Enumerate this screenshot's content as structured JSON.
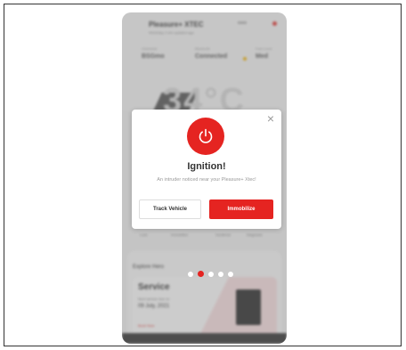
{
  "background_app": {
    "title": "Pleasure+ XTEC",
    "subtitle": "Weekday 2 min updated ago",
    "stats": [
      {
        "label": "Odometer",
        "value": "BSGmo"
      },
      {
        "label": "Bluetooth",
        "value": "Connected"
      },
      {
        "label": "Fuel Level",
        "value": "Med"
      }
    ],
    "temperature": "34°C",
    "quick_actions": [
      "Lock",
      "Immobilize",
      "Geofence",
      "Diagnosis"
    ],
    "explore_title": "Explore Hero",
    "service_card": {
      "title": "Service",
      "line1": "Next service due on",
      "date": "09 July, 2021",
      "link": "Book Now"
    }
  },
  "modal": {
    "icon": "power-icon",
    "title": "Ignition!",
    "message": "An intruder noticed near your Pleasure+ Xtec!",
    "buttons": {
      "track": "Track Vehicle",
      "immobilize": "Immobilize"
    },
    "close_icon": "close-icon"
  },
  "pager": {
    "count": 5,
    "active_index": 1
  },
  "colors": {
    "accent": "#e52421",
    "overlay": "rgba(120,120,120,0.38)"
  }
}
